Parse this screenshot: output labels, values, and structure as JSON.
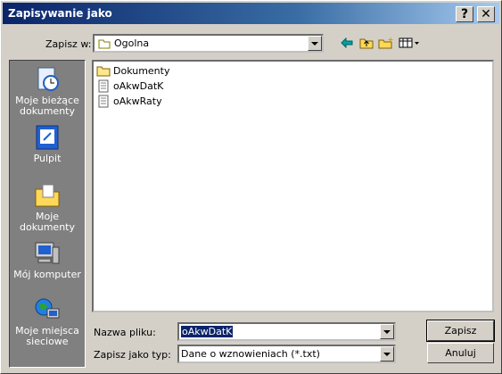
{
  "window": {
    "title": "Zapisywanie jako",
    "help_label": "?",
    "close_label": "✕"
  },
  "save_in": {
    "label": "Zapisz w:",
    "value": "Ogolna"
  },
  "toolbar": {
    "back": "back-icon",
    "up": "up-folder-icon",
    "new_folder": "new-folder-icon",
    "view": "view-menu-icon"
  },
  "places": [
    {
      "label": "Moje bieżące dokumenty",
      "icon": "recent-documents-icon"
    },
    {
      "label": "Pulpit",
      "icon": "desktop-icon"
    },
    {
      "label": "Moje dokumenty",
      "icon": "my-documents-icon"
    },
    {
      "label": "Mój komputer",
      "icon": "my-computer-icon"
    },
    {
      "label": "Moje miejsca sieciowe",
      "icon": "network-places-icon"
    }
  ],
  "files": [
    {
      "name": "Dokumenty",
      "type": "folder"
    },
    {
      "name": "oAkwDatK",
      "type": "file"
    },
    {
      "name": "oAkwRaty",
      "type": "file"
    }
  ],
  "filename": {
    "label": "Nazwa pliku:",
    "value": "oAkwDatK"
  },
  "filetype": {
    "label": "Zapisz jako typ:",
    "value": "Dane o wznowieniach (*.txt)"
  },
  "buttons": {
    "save": "Zapisz",
    "cancel": "Anuluj"
  },
  "colors": {
    "title_bar": "#0a246a",
    "dialog_bg": "#d4d0c8",
    "places_bg": "#808080",
    "selection": "#0a246a"
  }
}
